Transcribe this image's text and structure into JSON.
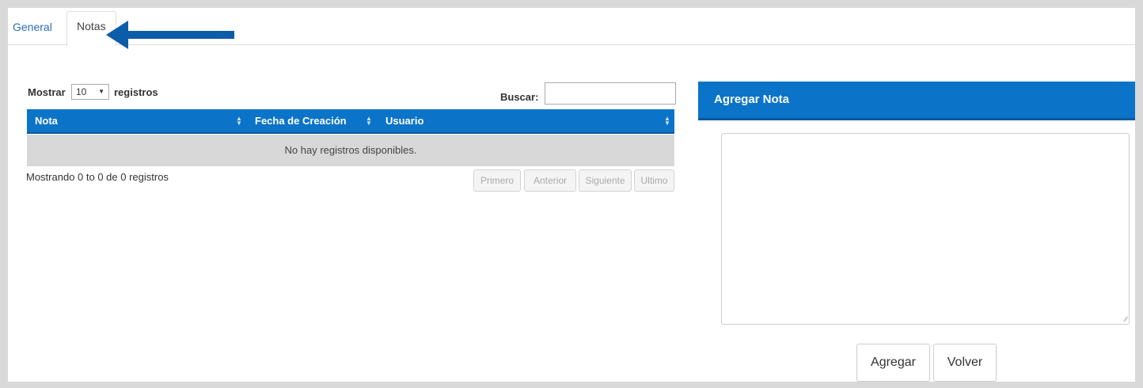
{
  "tabs": [
    {
      "label": "General",
      "active": false
    },
    {
      "label": "Notas",
      "active": true
    }
  ],
  "table_controls": {
    "show_label": "Mostrar",
    "show_value": "10",
    "show_suffix": "registros",
    "search_label": "Buscar:",
    "search_value": ""
  },
  "table": {
    "columns": [
      "Nota",
      "Fecha de Creación",
      "Usuario"
    ],
    "empty_message": "No hay registros disponibles.",
    "info": "Mostrando 0 to 0 de 0 registros"
  },
  "pagination": {
    "first": "Primero",
    "previous": "Anterior",
    "next": "Siguiente",
    "last": "Ultimo"
  },
  "add_note": {
    "title": "Agregar Nota",
    "textarea_value": "",
    "add_button": "Agregar",
    "back_button": "Volver"
  },
  "colors": {
    "accent": "#0b74c9",
    "arrow": "#0c5ca8",
    "background": "#d9d9d9"
  },
  "annotation": {
    "icon": "arrow-left-icon"
  }
}
